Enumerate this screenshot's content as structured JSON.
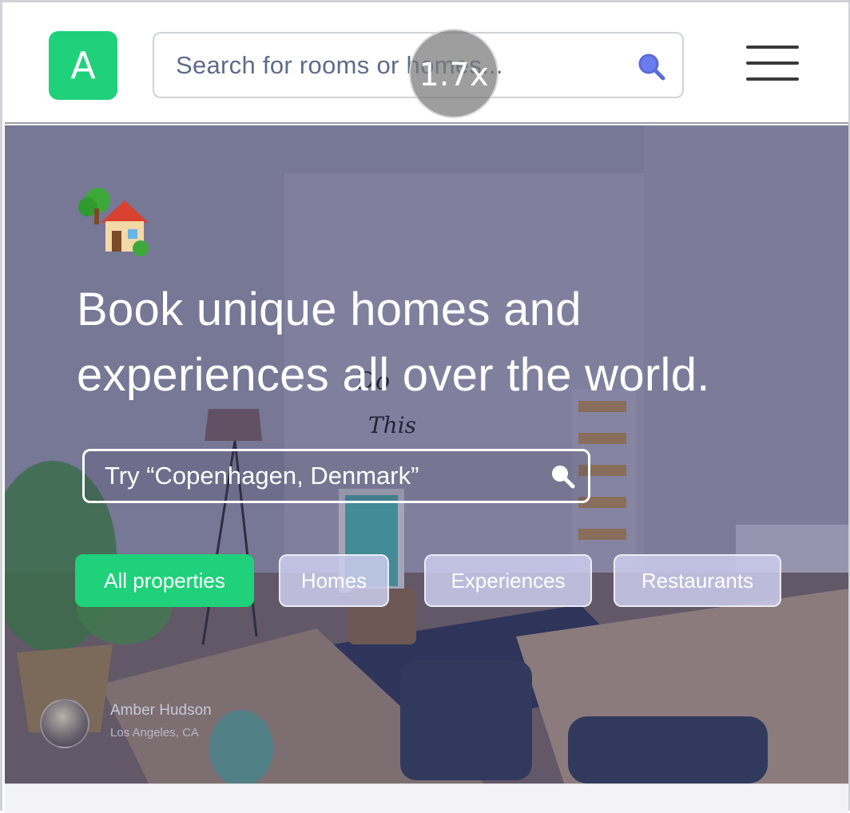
{
  "header": {
    "logo_letter": "A",
    "search_placeholder": "Search for rooms or homes..."
  },
  "zoom_indicator": "1.7x",
  "hero": {
    "title_line1": "Book unique homes and",
    "title_line2": "experiences all over the world.",
    "search_text": "Try “Copenhagen, Denmark”",
    "chips": [
      {
        "label": "All properties",
        "active": true
      },
      {
        "label": "Homes",
        "active": false
      },
      {
        "label": "Experiences",
        "active": false
      },
      {
        "label": "Restaurants",
        "active": false
      }
    ],
    "photo_credit": {
      "name": "Amber Hudson",
      "location": "Los Angeles, CA"
    }
  },
  "colors": {
    "accent": "#1fd17a",
    "chip_inactive": "#cdcdee",
    "hero_overlay": "#37375f"
  },
  "icons": [
    "search-icon",
    "menu-icon",
    "house-with-garden-icon"
  ]
}
